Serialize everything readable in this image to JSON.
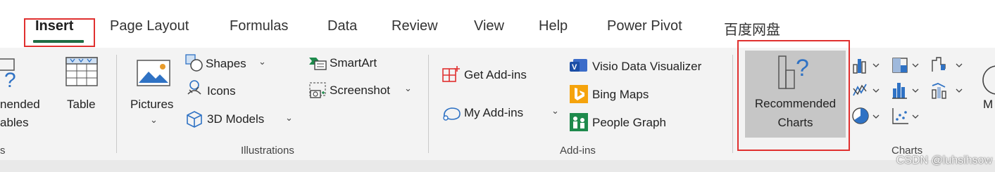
{
  "tabs": {
    "insert": "Insert",
    "page_layout": "Page Layout",
    "formulas": "Formulas",
    "data": "Data",
    "review": "Review",
    "view": "View",
    "help": "Help",
    "power_pivot": "Power Pivot",
    "baidu": "百度网盘"
  },
  "tables_group": {
    "recommended_line1": "nended",
    "recommended_line2": "ables",
    "group_label": "s",
    "table_label": "Table"
  },
  "illustrations": {
    "pictures": "Pictures",
    "shapes": "Shapes",
    "icons": "Icons",
    "models": "3D Models",
    "smartart": "SmartArt",
    "screenshot": "Screenshot",
    "group_label": "Illustrations"
  },
  "addins": {
    "get": "Get Add-ins",
    "my": "My Add-ins",
    "visio": "Visio Data Visualizer",
    "bing": "Bing Maps",
    "people": "People Graph",
    "group_label": "Add-ins"
  },
  "charts": {
    "rec_line1": "Recommended",
    "rec_line2": "Charts",
    "group_label": "Charts",
    "more_initial": "M"
  },
  "watermark": "CSDN @luhsihsow",
  "chevron": "⌄",
  "colors": {
    "insert_underline": "#1e6b43",
    "highlight_border": "#e0302f",
    "accent_blue": "#2f72c4"
  }
}
